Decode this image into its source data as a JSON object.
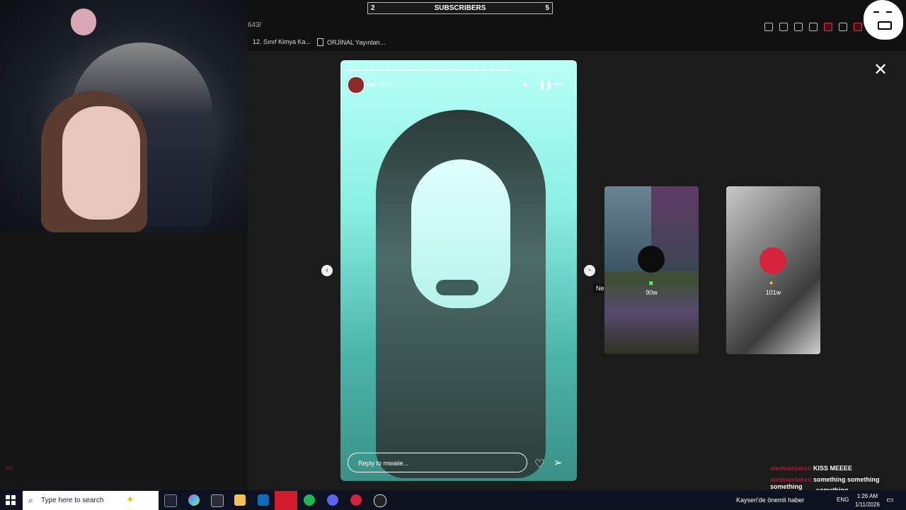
{
  "browser": {
    "address_fragment": "643/",
    "bookmarks": [
      "12. Sınıf Kimya Ka...",
      "ORJİNAL Yayınları..."
    ]
  },
  "subscribers_bar": {
    "left": "2",
    "label": "SUBSCRIBERS",
    "right": "5"
  },
  "story": {
    "username": "me",
    "time": "32w",
    "reply_placeholder": "Reply to mwaiie...",
    "segments_total": 30,
    "segments_done": 22
  },
  "navigation": {
    "next_tooltip": "Next"
  },
  "previews": [
    {
      "time": "90w"
    },
    {
      "time": "101w"
    }
  ],
  "chat": [
    {
      "name": "aledwastaken",
      "message": "KISS MEEEE"
    },
    {
      "name": "aledwastaken",
      "message": "something something something"
    },
    {
      "name": "",
      "message": "something"
    }
  ],
  "left_panel_text": [
    "ex",
    "..."
  ],
  "taskbar": {
    "search_placeholder": "Type here to search",
    "weather": "Kayseri'de önemli haber",
    "language": "ENG",
    "time": "1:26 AM",
    "date": "1/11/2026"
  },
  "colors": {
    "accent": "#b3103a",
    "story_tint": "#8af0e3",
    "subs_fill": "#7b3a8a"
  }
}
